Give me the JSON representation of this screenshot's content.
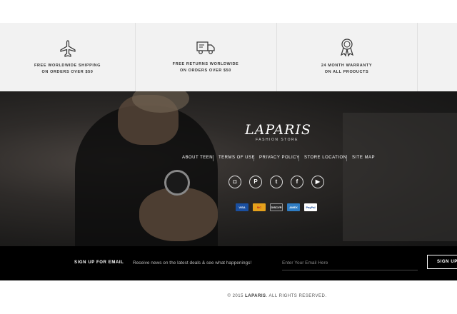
{
  "features": [
    {
      "icon": "airplane-icon",
      "line1": "FREE WORLDWIDE SHIPPING",
      "line2": "ON ORDERS OVER $50"
    },
    {
      "icon": "truck-icon",
      "line1": "FREE RETURNS WORLDWIDE",
      "line2": "ON ORDERS OVER $50"
    },
    {
      "icon": "award-ribbon-icon",
      "line1": "24 MONTH WARRANTY",
      "line2": "ON ALL PRODUCTS"
    }
  ],
  "brand": {
    "name": "LAPARIS",
    "tagline": "FASHION STORE"
  },
  "footer_links": [
    "ABOUT TEEN",
    "TERMS OF USE",
    "PRIVACY POLICY",
    "STORE LOCATION",
    "SITE MAP"
  ],
  "social": [
    {
      "icon": "instagram-icon",
      "glyph": "◘"
    },
    {
      "icon": "pinterest-icon",
      "glyph": "P"
    },
    {
      "icon": "twitter-icon",
      "glyph": "t"
    },
    {
      "icon": "facebook-icon",
      "glyph": "f"
    },
    {
      "icon": "youtube-icon",
      "glyph": "▶"
    }
  ],
  "payments": [
    {
      "icon": "visa-icon",
      "label": "VISA",
      "color": "#1a4fa0"
    },
    {
      "icon": "mastercard-icon",
      "label": "MC",
      "color": "#e5a11c"
    },
    {
      "icon": "discover-icon",
      "label": "DISCVR",
      "color": "#2b2b2b"
    },
    {
      "icon": "amex-icon",
      "label": "AMEX",
      "color": "#2f7dc4"
    },
    {
      "icon": "paypal-icon",
      "label": "PayPal",
      "color": "#ffffff"
    }
  ],
  "signup": {
    "title": "SIGN UP FOR EMAIL",
    "description": "Receive news on the latest deals & see what happenings!",
    "placeholder": "Enter Your Email Here",
    "button": "SIGN UP"
  },
  "copyright": {
    "prefix": "© 2015 ",
    "brand": "LAPARIS",
    "suffix": ". ALL RIGHTS RESERVED."
  }
}
